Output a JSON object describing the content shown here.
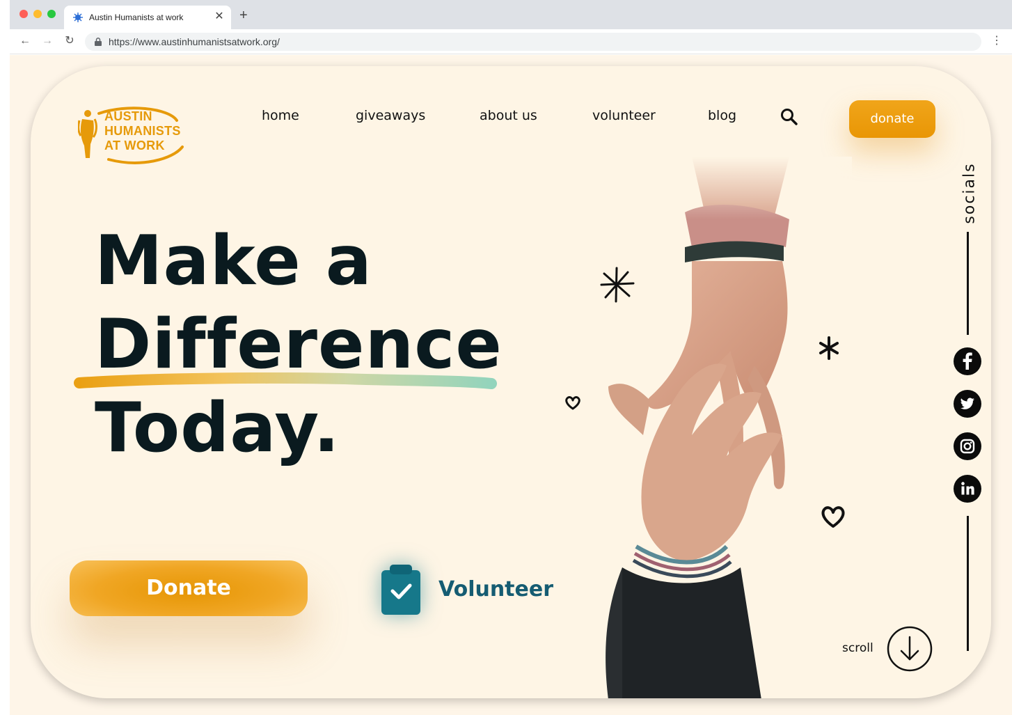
{
  "browser": {
    "tab_title": "Austin Humanists at work",
    "tab_close": "✕",
    "new_tab": "+",
    "url": "https://www.austinhumanistsatwork.org/",
    "back": "←",
    "forward": "→",
    "reload": "↻",
    "menu": "⋮"
  },
  "logo": {
    "line1": "AUSTIN",
    "line2": "HUMANISTS",
    "line3": "AT WORK",
    "color": "#e69a0a"
  },
  "nav": {
    "items": [
      "home",
      "giveaways",
      "about us",
      "volunteer",
      "blog"
    ],
    "search_icon": "search-icon",
    "donate_label": "donate"
  },
  "hero": {
    "line1": "Make a",
    "line2": "Difference",
    "line3": "Today.",
    "donate_label": "Donate",
    "volunteer_label": "Volunteer"
  },
  "side": {
    "socials_label": "socials",
    "social_icons": [
      "facebook-icon",
      "twitter-icon",
      "instagram-icon",
      "linkedin-icon"
    ],
    "scroll_label": "scroll"
  },
  "colors": {
    "background": "#fef5e5",
    "accent": "#eb9c0d",
    "headline": "#0a1a1f",
    "volunteer": "#155c72"
  }
}
